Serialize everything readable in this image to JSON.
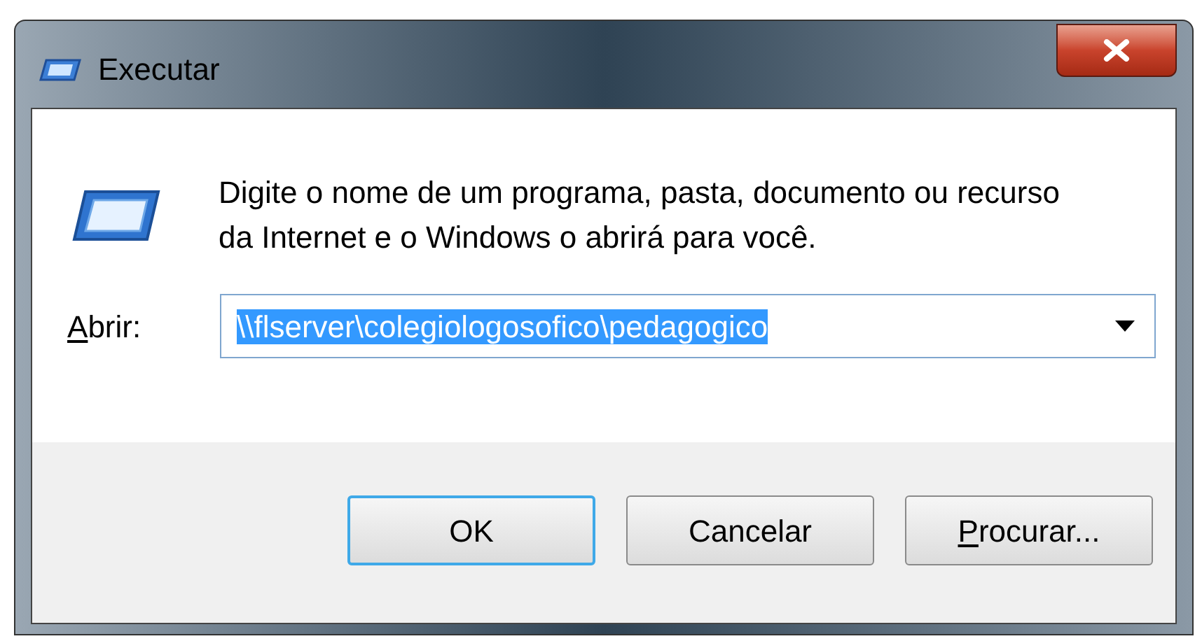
{
  "window": {
    "title": "Executar"
  },
  "message": "Digite o nome de um programa, pasta, documento ou recurso da Internet e o Windows o abrirá para você.",
  "open_field": {
    "label": "Abrir:",
    "label_access_key": true,
    "value": "\\\\flserver\\colegiologosofico\\pedagogico",
    "value_selected": true
  },
  "buttons": [
    {
      "label": "OK",
      "focused": true,
      "access_key": false
    },
    {
      "label": "Cancelar",
      "focused": false,
      "access_key": false
    },
    {
      "label": "Procurar...",
      "focused": false,
      "access_key": true
    }
  ]
}
